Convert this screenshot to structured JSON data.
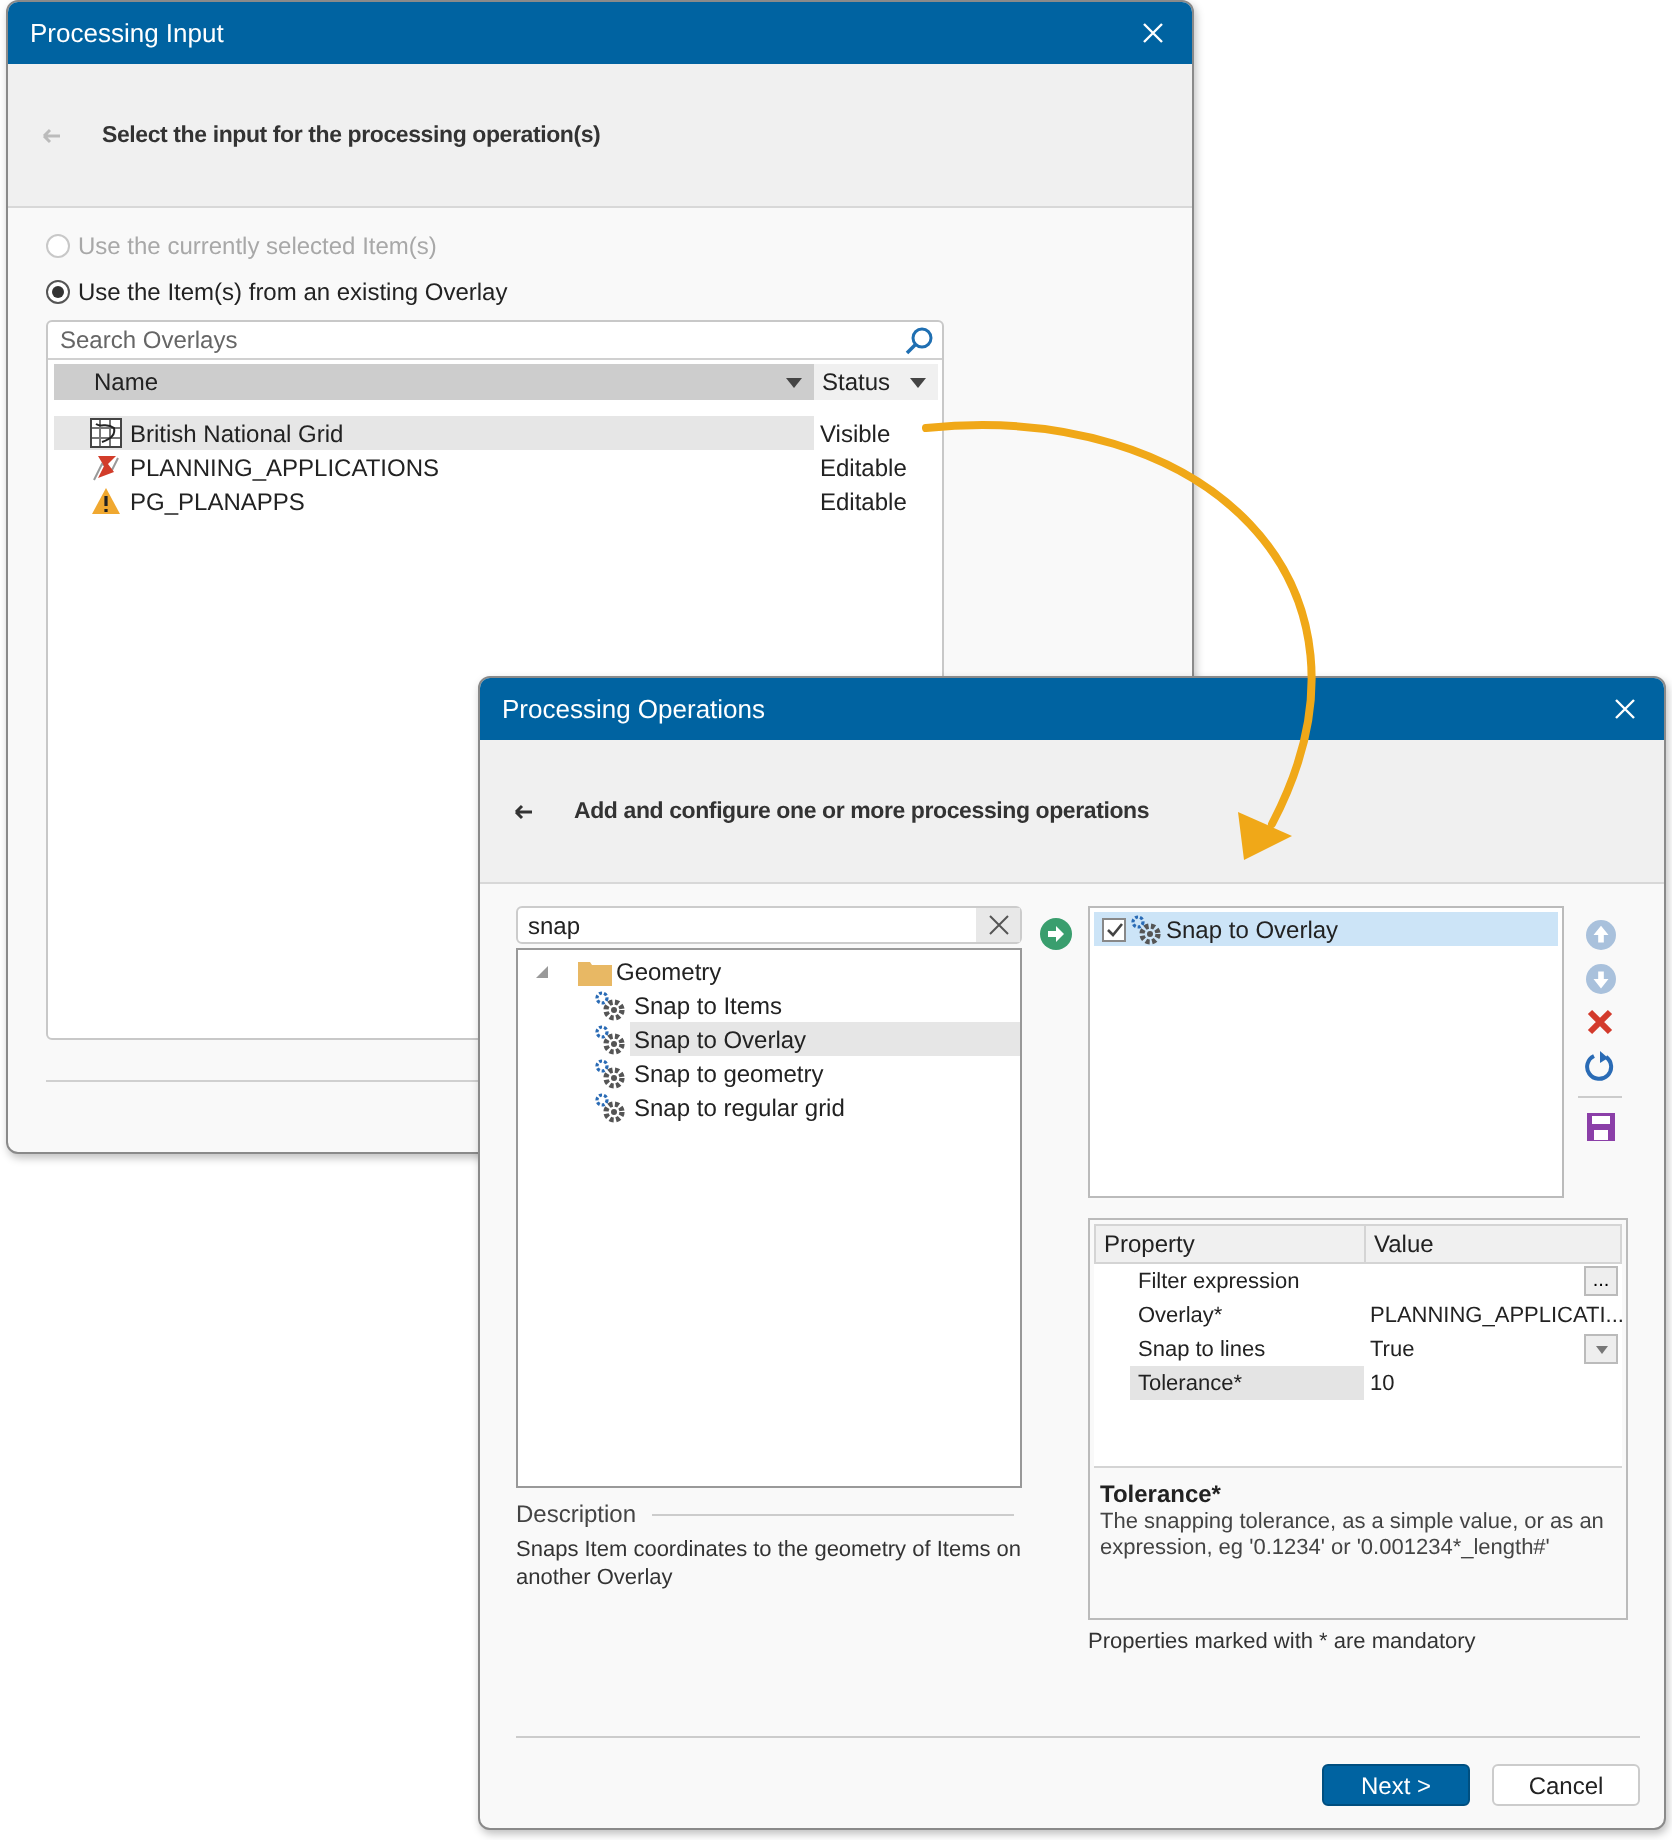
{
  "input_window": {
    "title": "Processing Input",
    "back_enabled": false,
    "heading": "Select the input for the processing operation(s)",
    "options": [
      {
        "label": "Use the currently selected Item(s)",
        "selected": false,
        "disabled": true
      },
      {
        "label": "Use the Item(s) from an existing Overlay",
        "selected": true,
        "disabled": false
      }
    ],
    "search": {
      "placeholder": "Search Overlays"
    },
    "columns": [
      "Name",
      "Status"
    ],
    "rows": [
      {
        "kind": "grid",
        "name": "British National Grid",
        "status": "Visible",
        "selected": true
      },
      {
        "kind": "feature",
        "name": "PLANNING_APPLICATIONS",
        "status": "Editable",
        "selected": false
      },
      {
        "kind": "warning",
        "name": "PG_PLANAPPS",
        "status": "Editable",
        "selected": false
      }
    ]
  },
  "operations_window": {
    "title": "Processing Operations",
    "back_enabled": true,
    "heading": "Add and configure one or more processing operations",
    "search": {
      "value": "snap"
    },
    "tree": [
      {
        "label": "Geometry",
        "expanded": true,
        "children": [
          {
            "label": "Snap to Items",
            "selected": false
          },
          {
            "label": "Snap to Overlay",
            "selected": true
          },
          {
            "label": "Snap to geometry",
            "selected": false
          },
          {
            "label": "Snap to regular grid",
            "selected": false
          }
        ]
      }
    ],
    "description": {
      "label": "Description",
      "text": "Snaps Item coordinates to the geometry of Items on another Overlay"
    },
    "operations": [
      {
        "label": "Snap to Overlay",
        "checked": true,
        "selected": true
      }
    ],
    "property_grid": {
      "columns": [
        "Property",
        "Value"
      ],
      "rows": [
        {
          "kind": "ellipsis",
          "property": "Filter expression",
          "value": "",
          "button": "...",
          "selected": false
        },
        {
          "kind": "text",
          "property": "Overlay*",
          "value": "PLANNING_APPLICATI...",
          "selected": false
        },
        {
          "kind": "dropdown",
          "property": "Snap to lines",
          "value": "True",
          "selected": false
        },
        {
          "kind": "text",
          "property": "Tolerance*",
          "value": "10",
          "selected": true
        }
      ],
      "help_title": "Tolerance*",
      "help_text": "The snapping tolerance, as a simple value, or as an expression, eg '0.1234' or '0.001234*_length#'"
    },
    "note": "Properties marked with * are mandatory",
    "buttons": [
      {
        "label": "Next >",
        "kind": "primary"
      },
      {
        "label": "Cancel",
        "kind": "secondary"
      }
    ]
  }
}
